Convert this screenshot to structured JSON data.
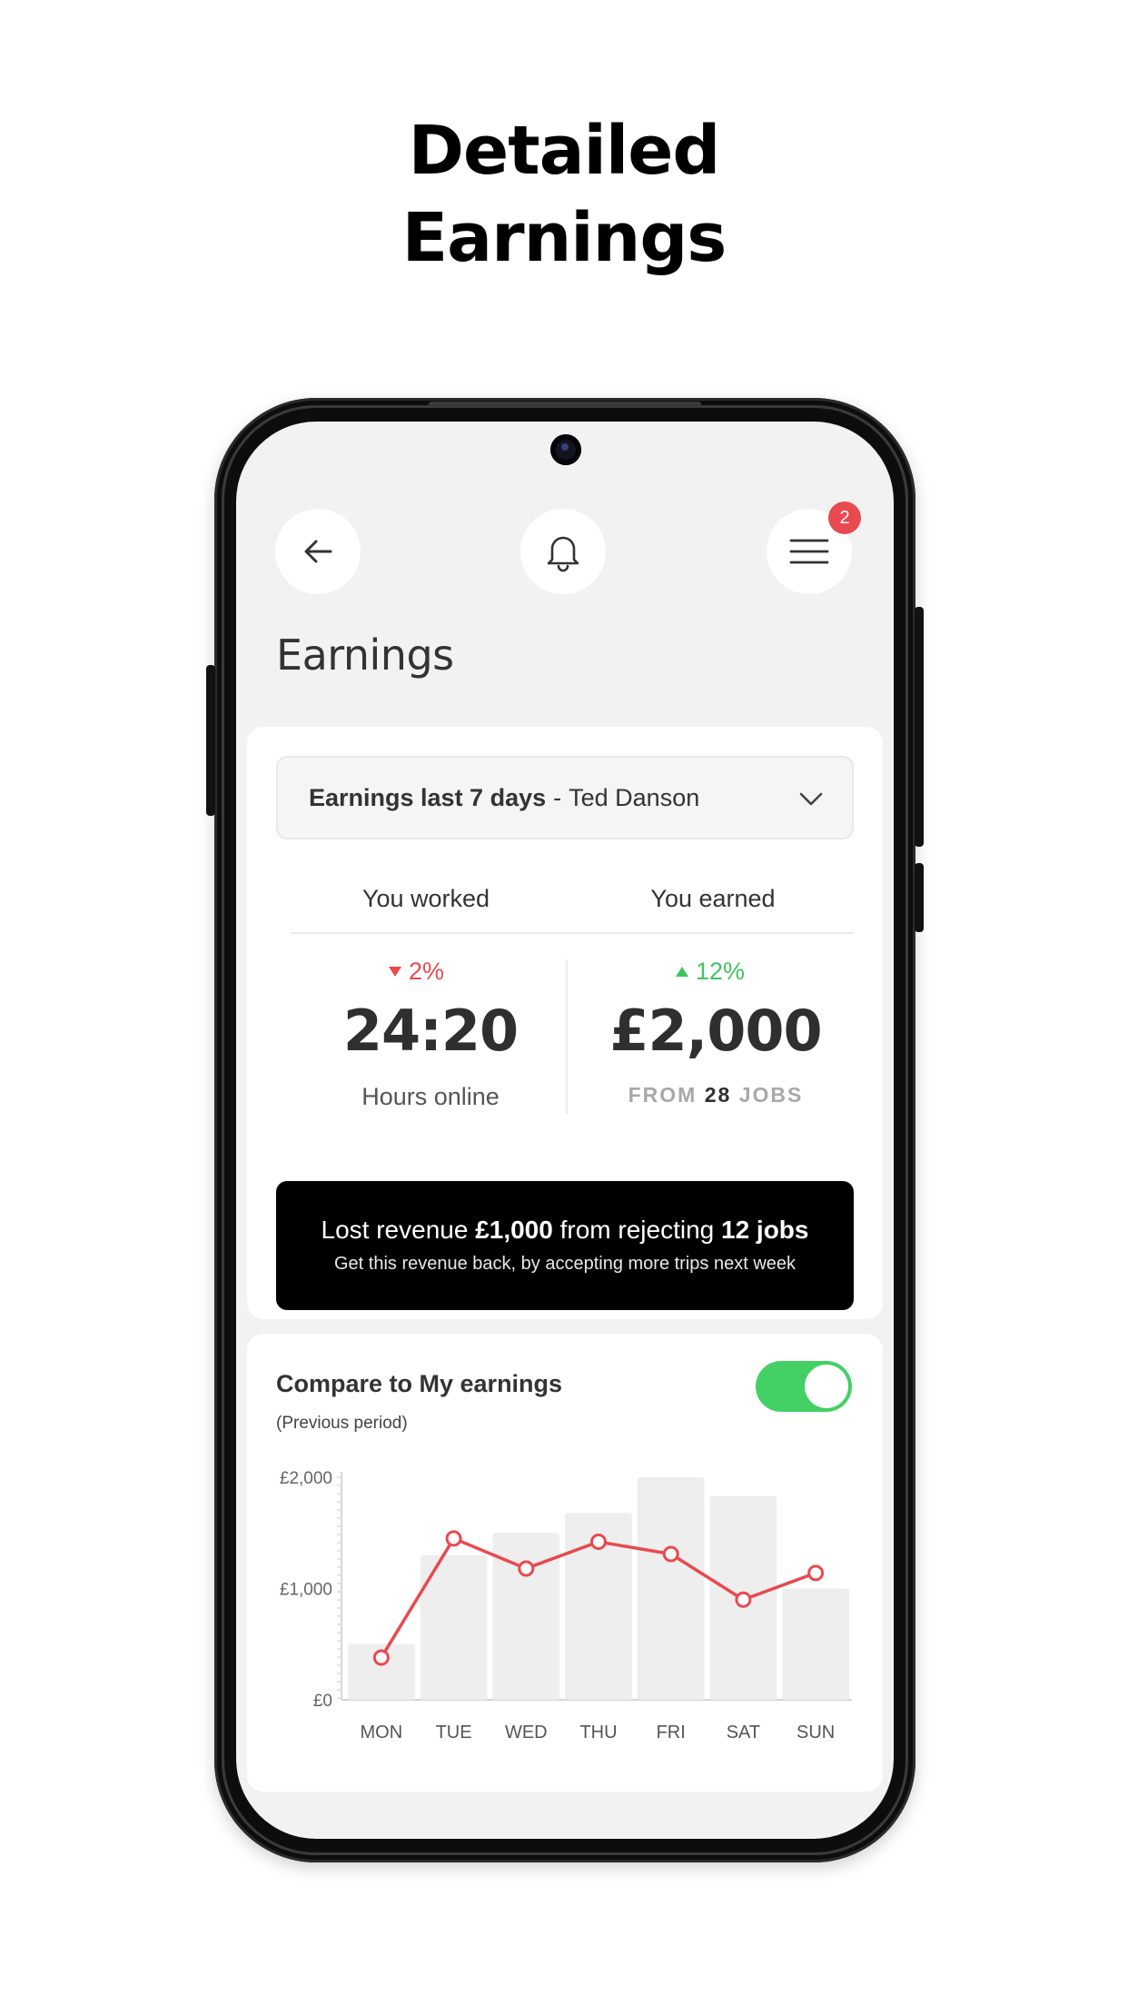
{
  "headline": {
    "line1": "Detailed",
    "line2": "Earnings"
  },
  "header": {
    "notification_count": "2"
  },
  "page_title": "Earnings",
  "selector": {
    "bold": "Earnings last 7 days",
    "separator": "-",
    "person": "Ted Danson"
  },
  "stats": {
    "worked_label": "You worked",
    "earned_label": "You earned",
    "hours_delta": "2%",
    "earned_delta": "12%",
    "hours_value": "24:20",
    "hours_caption": "Hours online",
    "earned_value": "£2,000",
    "jobs_from": "FROM",
    "jobs_count": "28",
    "jobs_word": "JOBS"
  },
  "banner": {
    "pre": "Lost revenue ",
    "amount": "£1,000",
    "mid": " from rejecting ",
    "jobs": "12 jobs",
    "subtext": "Get this revenue back, by accepting more trips next week"
  },
  "compare": {
    "title": "Compare to My earnings",
    "subtitle": "(Previous period)",
    "toggle_on": true
  },
  "colors": {
    "accent_red": "#e84a4f",
    "accent_green": "#3fc45f",
    "bar": "#eeeeee"
  },
  "chart_data": {
    "type": "bar",
    "categories": [
      "MON",
      "TUE",
      "WED",
      "THU",
      "FRI",
      "SAT",
      "SUN"
    ],
    "yticks": [
      "£0",
      "£1,000",
      "£2,000"
    ],
    "ylim": [
      0,
      2000
    ],
    "series": [
      {
        "values": [
          500,
          1300,
          1500,
          1680,
          2000,
          1830,
          1000
        ]
      },
      {
        "values": [
          380,
          1450,
          1180,
          1420,
          1310,
          900,
          1140
        ]
      }
    ]
  }
}
